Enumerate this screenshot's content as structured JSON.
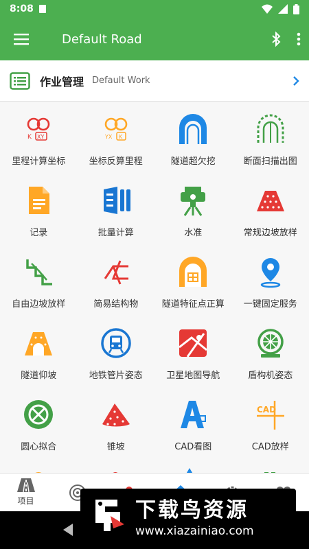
{
  "status": {
    "time": "8:08"
  },
  "appbar": {
    "title": "Default Road"
  },
  "work": {
    "label": "作业管理",
    "sub": "Default Work"
  },
  "grid": [
    {
      "label": "里程计算坐标",
      "icon": "mileage-to-coordinate-icon"
    },
    {
      "label": "坐标反算里程",
      "icon": "coordinate-to-mileage-icon"
    },
    {
      "label": "隧道超欠挖",
      "icon": "tunnel-overbreak-icon"
    },
    {
      "label": "断面扫描出图",
      "icon": "section-scan-icon"
    },
    {
      "label": "记录",
      "icon": "record-icon"
    },
    {
      "label": "批量计算",
      "icon": "batch-calc-icon"
    },
    {
      "label": "水准",
      "icon": "leveling-icon"
    },
    {
      "label": "常规边坡放样",
      "icon": "slope-stakeout-icon"
    },
    {
      "label": "自由边坡放样",
      "icon": "free-slope-icon"
    },
    {
      "label": "简易结构物",
      "icon": "simple-structure-icon"
    },
    {
      "label": "隧道特征点正算",
      "icon": "tunnel-feature-point-icon"
    },
    {
      "label": "一键固定服务",
      "icon": "location-pin-icon"
    },
    {
      "label": "隧道仰坡",
      "icon": "tunnel-slope-icon"
    },
    {
      "label": "地铁管片姿态",
      "icon": "metro-segment-icon"
    },
    {
      "label": "卫星地图导航",
      "icon": "satellite-map-icon"
    },
    {
      "label": "盾构机姿态",
      "icon": "shield-machine-icon"
    },
    {
      "label": "圆心拟合",
      "icon": "circle-fit-icon"
    },
    {
      "label": "锥坡",
      "icon": "cone-slope-icon"
    },
    {
      "label": "CAD看图",
      "icon": "cad-view-icon"
    },
    {
      "label": "CAD放样",
      "icon": "cad-stakeout-icon"
    }
  ],
  "bottomnav": [
    {
      "label": "项目",
      "icon": "road-icon"
    }
  ],
  "watermark": {
    "title": "下载鸟资源",
    "url": "www.xiazainiao.com"
  },
  "colors": {
    "primary": "#4caf50",
    "accent": "#1e88e5",
    "red": "#e53935",
    "orange": "#ffa726",
    "blue": "#1976d2",
    "green": "#43a047"
  }
}
